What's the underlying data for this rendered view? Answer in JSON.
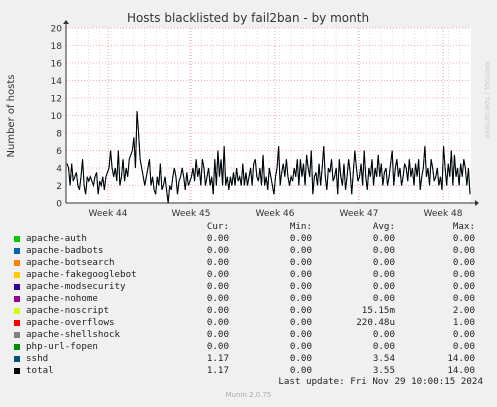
{
  "chart_data": {
    "type": "line",
    "title": "Hosts blacklisted by fail2ban - by month",
    "ylabel": "Number of hosts",
    "xlabel": "",
    "ylim": [
      0,
      20
    ],
    "yticks": [
      0,
      2,
      4,
      6,
      8,
      10,
      12,
      14,
      16,
      18,
      20
    ],
    "xticks": [
      "Week 44",
      "Week 45",
      "Week 46",
      "Week 47",
      "Week 48"
    ],
    "grid": true,
    "watermark": "RRDTOOL / TOBI OETIKER",
    "series": [
      {
        "name": "total",
        "color": "#000000",
        "values": [
          4.5,
          4,
          2,
          4.5,
          2.5,
          3,
          3.5,
          2,
          1.5,
          3,
          5,
          2,
          1,
          3,
          2.5,
          3,
          2.5,
          2,
          3,
          3.5,
          1,
          2.5,
          2,
          3,
          1.5,
          3,
          3.5,
          4,
          6,
          4,
          3,
          4,
          2.5,
          6,
          2,
          3,
          5,
          2.5,
          4,
          3,
          5,
          5.5,
          6,
          7.5,
          4,
          10.5,
          8,
          5,
          4,
          3,
          2,
          3,
          4,
          5,
          2,
          3,
          1.5,
          1,
          3,
          2,
          4.5,
          1.5,
          2,
          3,
          1.5,
          0,
          2,
          1.5,
          3,
          4,
          3,
          1,
          2.5,
          3,
          4,
          3,
          1.5,
          3.5,
          2,
          2.5,
          3,
          4,
          2.5,
          5,
          3,
          4,
          2,
          5,
          4,
          2,
          3,
          4,
          2,
          3,
          1,
          5,
          2,
          6,
          3,
          5,
          2,
          6.5,
          2,
          3,
          1.5,
          3,
          2,
          3.5,
          2,
          4,
          2.5,
          3,
          2,
          4.5,
          2,
          3.5,
          2,
          3,
          4,
          2,
          4.5,
          5,
          3,
          2.5,
          4,
          2,
          5.5,
          2,
          3,
          1.5,
          4,
          3,
          2,
          1,
          3,
          4,
          6.5,
          2,
          3.5,
          4.5,
          3,
          5,
          3,
          2,
          3,
          2.5,
          4,
          3,
          5,
          2,
          5,
          3,
          4.5,
          2,
          5.5,
          4,
          3,
          6,
          1,
          3,
          3.5,
          2,
          4.5,
          2,
          4,
          6.5,
          3,
          1.5,
          4,
          3.5,
          5,
          2.5,
          3,
          4,
          1,
          5,
          3,
          2,
          4.5,
          1.5,
          3,
          5,
          3.5,
          1,
          3.5,
          6,
          4,
          2.5,
          3,
          4.5,
          2,
          6,
          3,
          1.5,
          4,
          3,
          5,
          2,
          4,
          3,
          5.5,
          3,
          4.5,
          2,
          3.5,
          4,
          2,
          3,
          4.5,
          6,
          2,
          4,
          5,
          3,
          4,
          2,
          3,
          4.5,
          4,
          2.5,
          5,
          3,
          4,
          2,
          4.5,
          3,
          5,
          1.5,
          3,
          4,
          6.5,
          3,
          4,
          2,
          5,
          4,
          2.5,
          3,
          4,
          2,
          3,
          1.5,
          6.5,
          4,
          2,
          4.5,
          3,
          6,
          2,
          5.5,
          3,
          4,
          2,
          4.5,
          3,
          5,
          4,
          2,
          4,
          1
        ]
      },
      {
        "name": "sshd",
        "color": "#00527a",
        "values": [
          4.5,
          4,
          2,
          4.5,
          2.5,
          3,
          3.5,
          2,
          1.5,
          3,
          5,
          2,
          1,
          3,
          2.5,
          3,
          2.5,
          2,
          3,
          3.5,
          1,
          2.5,
          2,
          3,
          1.5,
          3,
          3.5,
          4,
          6,
          4,
          3,
          4,
          2.5,
          6,
          2,
          3,
          5,
          2.5,
          4,
          3,
          5,
          5.5,
          6,
          7.5,
          4,
          10.5,
          8,
          5,
          4,
          3,
          2,
          3,
          4,
          5,
          2,
          3,
          1.5,
          1,
          3,
          2,
          4.5,
          1.5,
          2,
          3,
          1.5,
          0,
          2,
          1.5,
          3,
          4,
          3,
          1,
          2.5,
          3,
          4,
          3,
          1.5,
          3.5,
          2,
          2.5,
          3,
          4,
          2.5,
          5,
          3,
          4,
          2,
          5,
          4,
          2,
          3,
          4,
          2,
          3,
          1,
          5,
          2,
          6,
          3,
          5,
          2,
          6.5,
          2,
          3,
          1.5,
          3,
          2,
          3.5,
          2,
          4,
          2.5,
          3,
          2,
          4.5,
          2,
          3.5,
          2,
          3,
          4,
          2,
          4.5,
          5,
          3,
          2.5,
          4,
          2,
          5.5,
          2,
          3,
          1.5,
          4,
          3,
          2,
          1,
          3,
          4,
          6.5,
          2,
          3.5,
          4.5,
          3,
          5,
          3,
          2,
          3,
          2.5,
          4,
          3,
          5,
          2,
          5,
          3,
          4.5,
          2,
          5.5,
          4,
          3,
          6,
          1,
          3,
          3.5,
          2,
          4.5,
          2,
          4,
          6.5,
          3,
          1.5,
          4,
          3.5,
          5,
          2.5,
          3,
          4,
          1,
          5,
          3,
          2,
          4.5,
          1.5,
          3,
          5,
          3.5,
          1,
          3.5,
          6,
          4,
          2.5,
          3,
          4.5,
          2,
          6,
          3,
          1.5,
          4,
          3,
          5,
          2,
          4,
          3,
          5.5,
          3,
          4.5,
          2,
          3.5,
          4,
          2,
          3,
          4.5,
          6,
          2,
          4,
          5,
          3,
          4,
          2,
          3,
          4.5,
          4,
          2.5,
          5,
          3,
          4,
          2,
          4.5,
          3,
          5,
          1.5,
          3,
          4,
          6.5,
          3,
          4,
          2,
          5,
          4,
          2.5,
          3,
          4,
          2,
          3,
          1.5,
          6.5,
          4,
          2,
          4.5,
          3,
          6,
          2,
          5.5,
          3,
          4,
          2,
          4.5,
          3,
          5,
          4,
          2,
          4,
          1
        ]
      }
    ]
  },
  "legend": {
    "headers": {
      "cur": "Cur:",
      "min": "Min:",
      "avg": "Avg:",
      "max": "Max:"
    },
    "rows": [
      {
        "name": "apache-auth",
        "color": "#00cc00",
        "cur": "0.00",
        "min": "0.00",
        "avg": "0.00",
        "max": "0.00"
      },
      {
        "name": "apache-badbots",
        "color": "#0066b3",
        "cur": "0.00",
        "min": "0.00",
        "avg": "0.00",
        "max": "0.00"
      },
      {
        "name": "apache-botsearch",
        "color": "#ff8000",
        "cur": "0.00",
        "min": "0.00",
        "avg": "0.00",
        "max": "0.00"
      },
      {
        "name": "apache-fakegooglebot",
        "color": "#ffcc00",
        "cur": "0.00",
        "min": "0.00",
        "avg": "0.00",
        "max": "0.00"
      },
      {
        "name": "apache-modsecurity",
        "color": "#330099",
        "cur": "0.00",
        "min": "0.00",
        "avg": "0.00",
        "max": "0.00"
      },
      {
        "name": "apache-nohome",
        "color": "#990099",
        "cur": "0.00",
        "min": "0.00",
        "avg": "0.00",
        "max": "0.00"
      },
      {
        "name": "apache-noscript",
        "color": "#ccff00",
        "cur": "0.00",
        "min": "0.00",
        "avg": "15.15m",
        "max": "2.00"
      },
      {
        "name": "apache-overflows",
        "color": "#ff0000",
        "cur": "0.00",
        "min": "0.00",
        "avg": "220.48u",
        "max": "1.00"
      },
      {
        "name": "apache-shellshock",
        "color": "#808080",
        "cur": "0.00",
        "min": "0.00",
        "avg": "0.00",
        "max": "0.00"
      },
      {
        "name": "php-url-fopen",
        "color": "#008f00",
        "cur": "0.00",
        "min": "0.00",
        "avg": "0.00",
        "max": "0.00"
      },
      {
        "name": "sshd",
        "color": "#00527a",
        "cur": "1.17",
        "min": "0.00",
        "avg": "3.54",
        "max": "14.00"
      },
      {
        "name": "total",
        "color": "#000000",
        "cur": "1.17",
        "min": "0.00",
        "avg": "3.55",
        "max": "14.00"
      }
    ]
  },
  "last_update": "Last update: Fri Nov 29 10:00:15 2024",
  "footer": "Munin 2.0.75"
}
